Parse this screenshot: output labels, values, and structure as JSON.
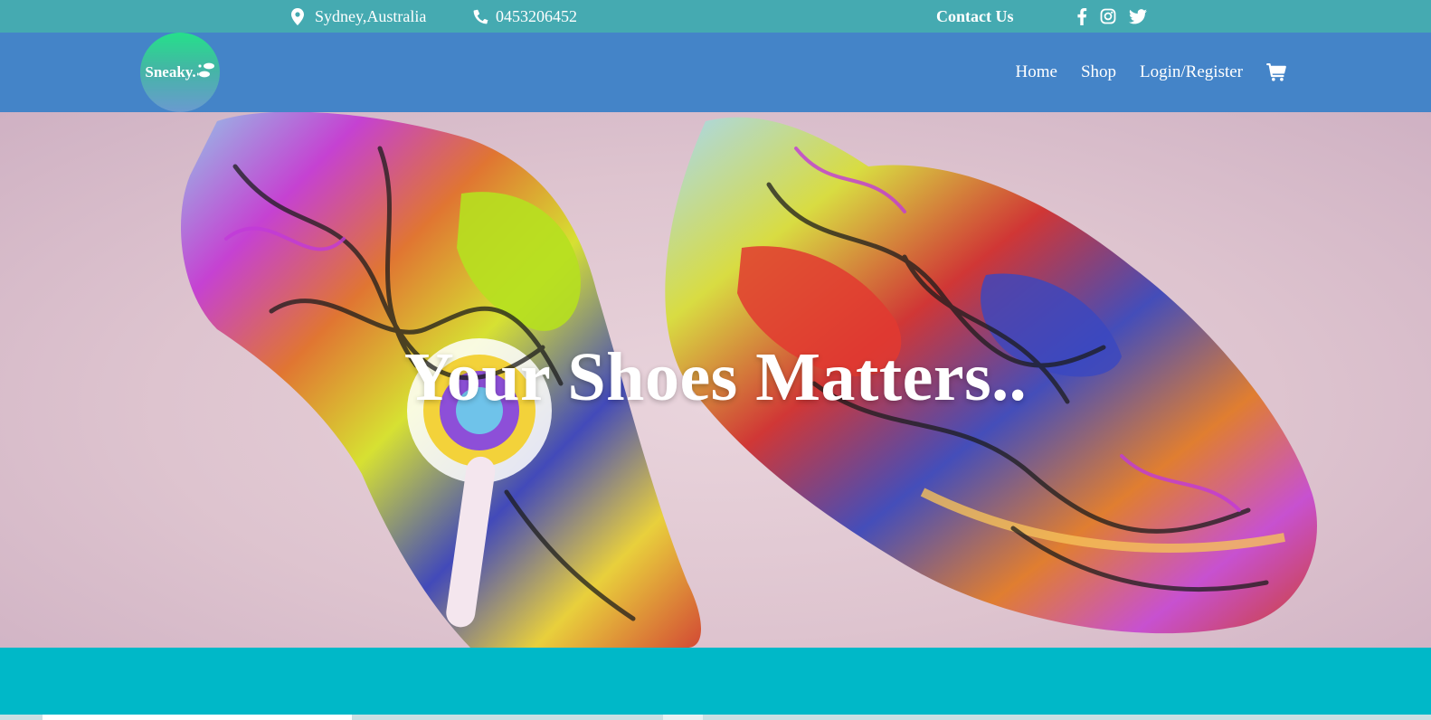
{
  "topbar": {
    "location_icon": "map-marker-icon",
    "location": "Sydney,Australia",
    "phone_icon": "phone-icon",
    "phone": "0453206452",
    "contact_label": "Contact Us",
    "social": [
      "facebook-icon",
      "instagram-icon",
      "twitter-icon"
    ],
    "background": "#45aab1"
  },
  "navbar": {
    "logo_text": "Sneaky.",
    "logo_icon": "shoe-prints-icon",
    "links": [
      "Home",
      "Shop",
      "Login/Register"
    ],
    "cart_icon": "shopping-cart-icon",
    "background": "#4484c8"
  },
  "hero": {
    "title": "Your Shoes Matters..",
    "background": "#e3ccd6"
  },
  "band": {
    "background": "#00b8c8"
  }
}
